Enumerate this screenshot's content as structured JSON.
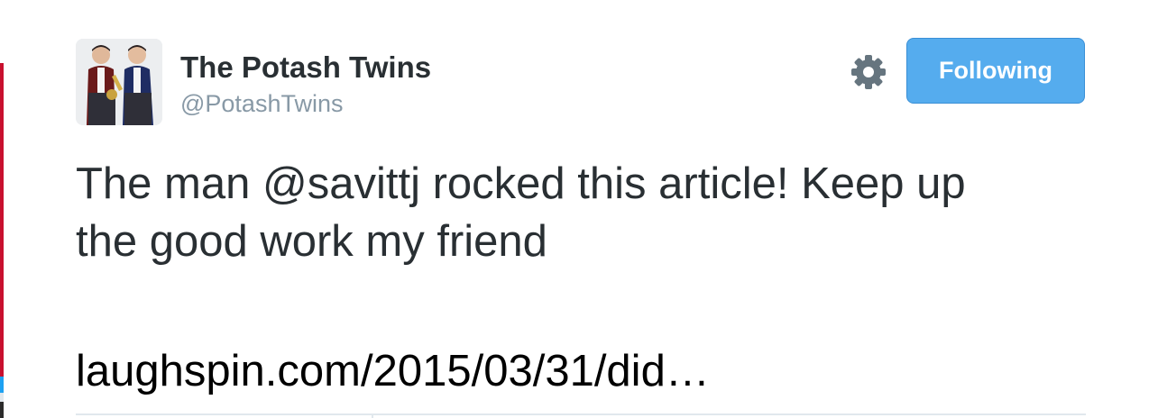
{
  "tweet": {
    "author": {
      "display_name": "The Potash Twins",
      "screen_name": "@PotashTwins",
      "avatar_icon": "twins-photo-avatar"
    },
    "actions": {
      "settings_icon": "gear-icon",
      "follow_label": "Following"
    },
    "text_lines": [
      "The man @savittj rocked this article! Keep up",
      "the good work my friend"
    ],
    "link_text": "laughspin.com/2015/03/31/did…"
  },
  "colors": {
    "follow_button": "#55acee",
    "text": "#292f33",
    "muted": "#8899a6",
    "divider": "#e1e8ed"
  }
}
